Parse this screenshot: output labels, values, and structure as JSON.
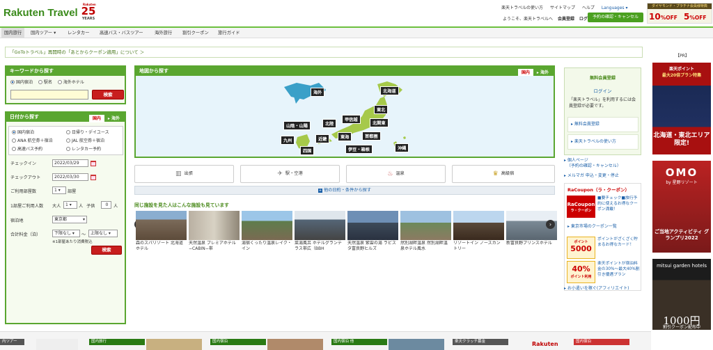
{
  "header": {
    "logo": "Rakuten Travel",
    "anniv_small": "Rakuten",
    "anniv_num": "25",
    "anniv_years": "YEARS",
    "top_links": [
      "楽天トラベルの使い方",
      "サイトマップ",
      "ヘルプ",
      "Languages ▾"
    ],
    "welcome": "ようこそ、楽天トラベルへ",
    "member_register": "会員登録",
    "login": "ログイン",
    "reserve_button": "予約の確認・キャンセル",
    "promo_title": "ダイヤモンド・プラチナ会員様特典",
    "promo_1": "10",
    "promo_1_suffix": "%OFF",
    "promo_2": "5",
    "promo_2_suffix": "%OFF",
    "promo_max": "最大"
  },
  "nav": [
    "国内旅行",
    "国内ツアー ▾",
    "レンタカー",
    "高速バス・バスツアー",
    "海外旅行",
    "割引クーポン",
    "旅行ガイド"
  ],
  "notice": "「GoToトラベル」再開時の「あとからクーポン適用」について ＞",
  "keyword": {
    "title": "キーワードから探す",
    "options": [
      "国内宿泊",
      "駅名",
      "海外ホテル"
    ],
    "search": "検索"
  },
  "date_search": {
    "title": "日付から探す",
    "tab_domestic": "国内",
    "tab_overseas": "▸ 海外",
    "types": [
      "国内宿泊",
      "日帰り・デイユース",
      "ANA 航空券＋宿泊",
      "JAL 航空券＋宿泊",
      "高速バス予約",
      "レンタカー予約"
    ],
    "checkin_label": "チェックイン",
    "checkin": "2022/03/29",
    "checkout_label": "チェックアウト",
    "checkout": "2022/03/30",
    "rooms_label": "ご利用部屋数",
    "rooms": "1",
    "rooms_unit": "部屋",
    "persons_label": "1部屋ご利用人数",
    "adult_label": "大人",
    "adult": "1",
    "adult_unit": "人",
    "child_label": "子供",
    "child": "0",
    "child_unit": "人",
    "area_label": "宿泊地",
    "area": "東京都",
    "price_label": "合計料金（泊）",
    "price_min": "下限なし",
    "price_max": "上限なし",
    "price_sep": "〜",
    "price_note": "※1部屋あたり消費税込",
    "search": "検索"
  },
  "map": {
    "title": "地図から探す",
    "tab_domestic": "国内",
    "tab_overseas": "▸ 海外",
    "regions": [
      "海外",
      "北海道",
      "東北",
      "甲信越",
      "北関東",
      "山陰・山陽",
      "北陸",
      "東海",
      "首都圏",
      "九州",
      "近畿",
      "伊豆・箱根",
      "沖縄",
      "四国"
    ]
  },
  "categories": [
    "出張",
    "駅・空港",
    "温泉",
    "高級宿"
  ],
  "more_conditions": "他の日約・条件から探す",
  "related": {
    "title": "同じ施設を見た人はこんな施設も見ています",
    "cards": [
      "森のスパリゾート 北海道ホテル",
      "天然温泉 プレミアホテル−CABIN−帯",
      "湯宿くったり温泉レイク・イン",
      "菜湯風呂 ホテルグランテラス帯広（BBH",
      "天然温泉 紫雲の湯 ラビスタ富良野ヒルズ",
      "然別湖畔温泉 然別湖畔温泉ホテル風水",
      "リゾートイン ノースカントリー",
      "新富良野プリンスホテル"
    ]
  },
  "member": {
    "title": "無料会員登録",
    "login": "ログイン",
    "desc": "「楽天トラベル」を利用するには会員登録が必要です。",
    "link1": "▸ 無料会員登録",
    "link2": "▸ 楽天トラベルの使い方",
    "personal_page": "個人ページ",
    "personal_page_sub": "（予約の確認・キャンセル）",
    "mailmag": "メルマガ 申込・変更・停止"
  },
  "racoupon": {
    "title": "RaCoupon（ラ・クーポン）",
    "logo": "RaCoupon",
    "logo_sub": "ラ・クーポン",
    "text1": "■要チェック■旅行予約に使えるお得なクーポン満載！",
    "link_city": "▸ 東京市場のクーポン一覧",
    "point_label": "ポイント",
    "points": "5000",
    "text2": "ポイントがざくざく貯まるお得なカード！",
    "pct": "40%",
    "pct_label": "ポイント利用",
    "text3": "楽天ポイントが宿泊料金の30%〜最大40%割引き優遇プラン",
    "affiliate": "お小遣いを稼ぐ(アフィリエイト)"
  },
  "ads": {
    "pr": "【PR】",
    "ad1_top": "楽天ポイント",
    "ad1_sub": "最大20倍プラン特集",
    "ad1_bottom": "北海道・東北エリア限定!",
    "ad2_title": "OMO",
    "ad2_sub": "by 星野リゾート",
    "ad2_bottom": "ご当地アクティビティ グランプリ2022",
    "ad3_title": "mitsui garden hotels",
    "ad3_bottom": "1000円",
    "ad3_bottom2": "割引クーポン配布中"
  },
  "bottom": {
    "left": "内ツアー",
    "b1": "国内旅行",
    "b2": "国内宿泊",
    "b3": "国内宿泊 他",
    "b4": "楽天クラッチ募金",
    "b5": "国内宿泊",
    "rakuten": "Rakuten"
  },
  "colors": {
    "brand_green": "#5aa630",
    "red": "#c81e1e",
    "link": "#1a5fa8"
  }
}
